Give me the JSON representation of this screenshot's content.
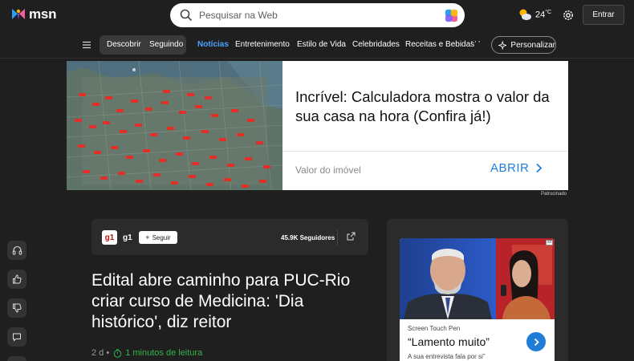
{
  "header": {
    "logo_text": "msn",
    "search_placeholder": "Pesquisar na Web",
    "weather_temp": "24",
    "weather_unit": "°C",
    "signin_label": "Entrar"
  },
  "nav": {
    "items": [
      "Descobrir",
      "Seguindo",
      "Notícias",
      "Entretenimento",
      "Estilo de Vida",
      "Celebridades",
      "Receitas e Bebidas"
    ],
    "active": "Notícias",
    "more": "···",
    "personalize_label": "Personalizar"
  },
  "ad": {
    "headline": "Incrível: Calculadora mostra o valor da sua casa na hora (Confira já!)",
    "field_label": "Valor do imóvel",
    "cta_label": "ABRIR",
    "sponsored_label": "Patrocinado"
  },
  "article": {
    "source_logo": "g1",
    "source_name": "g1",
    "follow_label": "Seguir",
    "followers": "45.9K Seguidores",
    "title": "Edital abre caminho para PUC-Rio criar curso de Medicina: 'Dia histórico', diz reitor",
    "age": "2 d •",
    "read_time": "1 minutos de leitura"
  },
  "promo": {
    "ad_badge": "ad",
    "source": "Screen Touch Pen",
    "title": "“Lamento muito”",
    "subtitle": "A sua entrevista fala por si”"
  },
  "colors": {
    "background": "#1f1f1f",
    "accent": "#4aa3ff",
    "ad_cta": "#1f7dd8",
    "read_time": "#32b34a"
  }
}
